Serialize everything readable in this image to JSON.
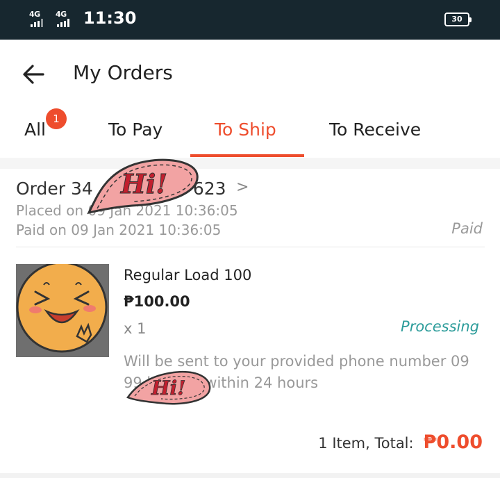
{
  "status_bar": {
    "signal_1": "4G",
    "signal_2": "4G",
    "time": "11:30",
    "battery": "30"
  },
  "header": {
    "title": "My Orders",
    "back_icon": "arrow-left-icon"
  },
  "tabs": [
    {
      "label": "All",
      "badge": "1",
      "active": false
    },
    {
      "label": "To Pay",
      "active": false
    },
    {
      "label": "To Ship",
      "active": true
    },
    {
      "label": "To Receive",
      "active": false
    }
  ],
  "order": {
    "id_prefix": "Order 34",
    "id_suffix": "623",
    "chevron": ">",
    "placed": "Placed on 09 Jan 2021 10:36:05",
    "paid": "Paid on 09 Jan 2021  10:36:05",
    "payment_status": "Paid"
  },
  "item": {
    "name": "Regular Load 100",
    "price": "₱100.00",
    "quantity": "x 1",
    "status": "Processing",
    "note": "Will be sent to your provided phone number 09 99 by SMS within 24 hours"
  },
  "summary": {
    "label": "1 Item, Total:",
    "total": "₱0.00"
  },
  "stickers": {
    "text_1": "Hi!",
    "text_2": "Hi!"
  },
  "colors": {
    "accent": "#ee4d2d",
    "status_bar": "#17272f",
    "processing": "#2c9c9a"
  }
}
